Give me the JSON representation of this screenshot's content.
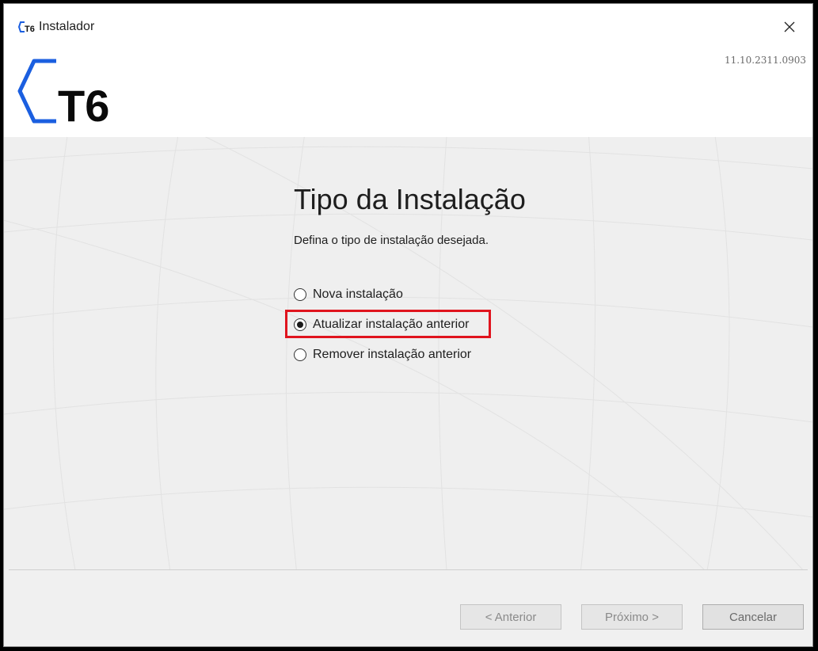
{
  "window": {
    "title": "Instalador",
    "version": "11.10.2311.0903",
    "logo_text": "T6"
  },
  "page": {
    "heading": "Tipo da Instalação",
    "subtitle": "Defina o tipo de instalação desejada."
  },
  "options": [
    {
      "label": "Nova instalação",
      "selected": false
    },
    {
      "label": "Atualizar instalação anterior",
      "selected": true
    },
    {
      "label": "Remover instalação anterior",
      "selected": false
    }
  ],
  "buttons": {
    "back": "< Anterior",
    "next": "Próximo >",
    "cancel": "Cancelar"
  },
  "colors": {
    "accent_blue": "#1b5fe0",
    "highlight_red": "#e0141e"
  }
}
